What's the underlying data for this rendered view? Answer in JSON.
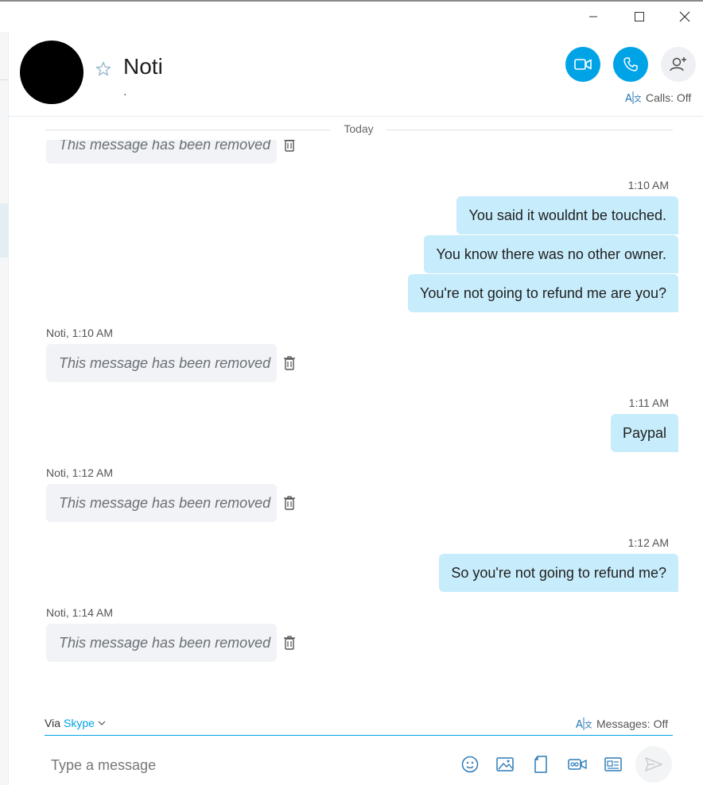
{
  "window": {
    "minimize": "–",
    "maximize": "□",
    "close": "✕"
  },
  "header": {
    "contact_name": "Noti",
    "status": ".",
    "calls_label": "Calls: Off"
  },
  "divider": {
    "label": "Today"
  },
  "messages": {
    "m0": {
      "text": "This message has been removed"
    },
    "t1": "1:10 AM",
    "o1": "You said it wouldnt be touched.",
    "o2": "You know there was no other owner.",
    "o3": "You're not going to refund me are you?",
    "i1_meta": "Noti, 1:10 AM",
    "i1": "This message has been removed",
    "t2": "1:11 AM",
    "o4": "Paypal",
    "i2_meta": "Noti, 1:12 AM",
    "i2": "This message has been removed",
    "t3": "1:12 AM",
    "o5": "So you're not going to refund me?",
    "i3_meta": "Noti, 1:14 AM",
    "i3": "This message has been removed"
  },
  "composer": {
    "via_label": "Via",
    "via_link": "Skype",
    "messages_label": "Messages: Off",
    "placeholder": "Type a message"
  },
  "colors": {
    "accent": "#00a3e6",
    "outgoing_bubble": "#c7ecfb",
    "incoming_bubble": "#f1f3f6"
  },
  "icons": [
    "star-icon",
    "video-call-icon",
    "phone-icon",
    "add-person-icon",
    "translate-icon",
    "trash-icon",
    "emoji-icon",
    "image-icon",
    "file-icon",
    "video-message-icon",
    "contact-card-icon",
    "send-icon",
    "chevron-down-icon"
  ]
}
